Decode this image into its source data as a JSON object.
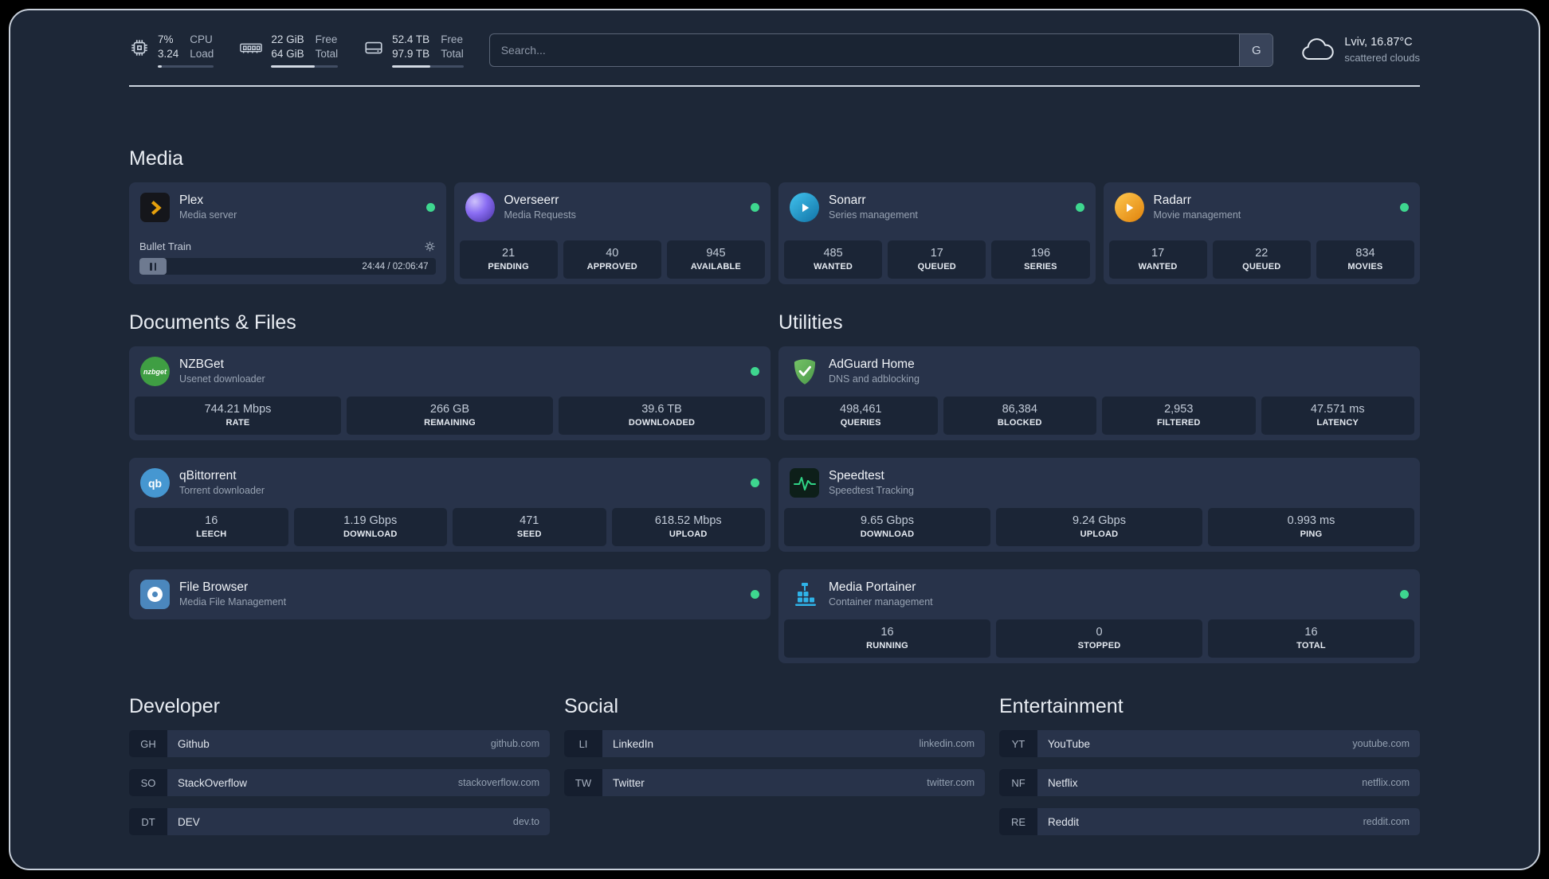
{
  "theme": {
    "background": "#1d2737",
    "card": "#28334a",
    "stat_block": "#1b2536",
    "status_online": "#3ed78f",
    "plex_amber": "#e5a00d",
    "overseerr_purple": "#8a6df3",
    "sonarr_blue": "#2193c9",
    "radarr_gold": "#f0a51c",
    "nzbget_green": "#3f9e43",
    "qbittorrent_blue": "#4697d1",
    "adguard_green": "#67b357",
    "speedtest_green": "#2fd385",
    "portainer_blue": "#2fb3e8"
  },
  "topbar": {
    "cpu": {
      "value1": "7%",
      "value2": "3.24",
      "label1": "CPU",
      "label2": "Load",
      "pct": 7
    },
    "mem": {
      "value1": "22 GiB",
      "value2": "64 GiB",
      "label1": "Free",
      "label2": "Total",
      "pct": 65
    },
    "disk": {
      "value1": "52.4 TB",
      "value2": "97.9 TB",
      "label1": "Free",
      "label2": "Total",
      "pct": 53
    },
    "search": {
      "placeholder": "Search...",
      "button_label": "G"
    },
    "weather": {
      "location": "Lviv, 16.87°C",
      "condition": "scattered clouds"
    }
  },
  "media": {
    "title": "Media",
    "plex": {
      "name": "Plex",
      "desc": "Media server",
      "now_playing": "Bullet Train",
      "time": "24:44 / 02:06:47"
    },
    "overseerr": {
      "name": "Overseerr",
      "desc": "Media Requests",
      "stats": [
        {
          "value": "21",
          "label": "PENDING"
        },
        {
          "value": "40",
          "label": "APPROVED"
        },
        {
          "value": "945",
          "label": "AVAILABLE"
        }
      ]
    },
    "sonarr": {
      "name": "Sonarr",
      "desc": "Series management",
      "stats": [
        {
          "value": "485",
          "label": "WANTED"
        },
        {
          "value": "17",
          "label": "QUEUED"
        },
        {
          "value": "196",
          "label": "SERIES"
        }
      ]
    },
    "radarr": {
      "name": "Radarr",
      "desc": "Movie management",
      "stats": [
        {
          "value": "17",
          "label": "WANTED"
        },
        {
          "value": "22",
          "label": "QUEUED"
        },
        {
          "value": "834",
          "label": "MOVIES"
        }
      ]
    }
  },
  "documents": {
    "title": "Documents & Files",
    "nzbget": {
      "name": "NZBGet",
      "desc": "Usenet downloader",
      "stats": [
        {
          "value": "744.21 Mbps",
          "label": "RATE"
        },
        {
          "value": "266 GB",
          "label": "REMAINING"
        },
        {
          "value": "39.6 TB",
          "label": "DOWNLOADED"
        }
      ]
    },
    "qbittorrent": {
      "name": "qBittorrent",
      "desc": "Torrent downloader",
      "stats": [
        {
          "value": "16",
          "label": "LEECH"
        },
        {
          "value": "1.19 Gbps",
          "label": "DOWNLOAD"
        },
        {
          "value": "471",
          "label": "SEED"
        },
        {
          "value": "618.52 Mbps",
          "label": "UPLOAD"
        }
      ]
    },
    "filebrowser": {
      "name": "File Browser",
      "desc": "Media File Management"
    }
  },
  "utilities": {
    "title": "Utilities",
    "adguard": {
      "name": "AdGuard Home",
      "desc": "DNS and adblocking",
      "stats": [
        {
          "value": "498,461",
          "label": "QUERIES"
        },
        {
          "value": "86,384",
          "label": "BLOCKED"
        },
        {
          "value": "2,953",
          "label": "FILTERED"
        },
        {
          "value": "47.571 ms",
          "label": "LATENCY"
        }
      ]
    },
    "speedtest": {
      "name": "Speedtest",
      "desc": "Speedtest Tracking",
      "stats": [
        {
          "value": "9.65 Gbps",
          "label": "DOWNLOAD"
        },
        {
          "value": "9.24 Gbps",
          "label": "UPLOAD"
        },
        {
          "value": "0.993 ms",
          "label": "PING"
        }
      ]
    },
    "portainer": {
      "name": "Media Portainer",
      "desc": "Container management",
      "stats": [
        {
          "value": "16",
          "label": "RUNNING"
        },
        {
          "value": "0",
          "label": "STOPPED"
        },
        {
          "value": "16",
          "label": "TOTAL"
        }
      ]
    }
  },
  "bookmarks": {
    "developer": {
      "title": "Developer",
      "items": [
        {
          "abbr": "GH",
          "name": "Github",
          "url": "github.com"
        },
        {
          "abbr": "SO",
          "name": "StackOverflow",
          "url": "stackoverflow.com"
        },
        {
          "abbr": "DT",
          "name": "DEV",
          "url": "dev.to"
        }
      ]
    },
    "social": {
      "title": "Social",
      "items": [
        {
          "abbr": "LI",
          "name": "LinkedIn",
          "url": "linkedin.com"
        },
        {
          "abbr": "TW",
          "name": "Twitter",
          "url": "twitter.com"
        }
      ]
    },
    "entertainment": {
      "title": "Entertainment",
      "items": [
        {
          "abbr": "YT",
          "name": "YouTube",
          "url": "youtube.com"
        },
        {
          "abbr": "NF",
          "name": "Netflix",
          "url": "netflix.com"
        },
        {
          "abbr": "RE",
          "name": "Reddit",
          "url": "reddit.com"
        }
      ]
    }
  }
}
